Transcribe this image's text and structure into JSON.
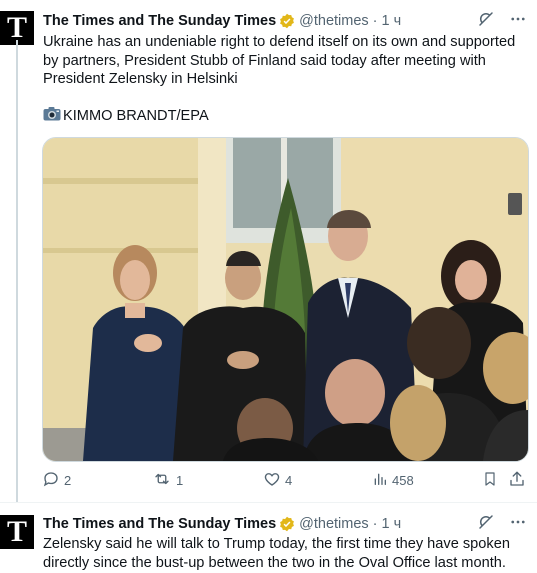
{
  "tweets": [
    {
      "author_name": "The Times and The Sunday Times",
      "handle": "@thetimes",
      "separator": "·",
      "time": "1 ч",
      "avatar_letter": "T",
      "text": "Ukraine has an undeniable right to defend itself on its own and supported by partners, President Stubb of Finland said today after meeting with President Zelensky in Helsinki",
      "photo_credit": "KIMMO BRANDT/EPA",
      "photo_credit_icon": "camera-icon",
      "stats": {
        "replies": "2",
        "reposts": "1",
        "likes": "4",
        "views": "458"
      }
    },
    {
      "author_name": "The Times and The Sunday Times",
      "handle": "@thetimes",
      "separator": "·",
      "time": "1 ч",
      "avatar_letter": "T",
      "text": "Zelensky said he will talk to Trump today, the first time they have spoken directly since the bust-up between the two in the Oval Office last month."
    }
  ],
  "colors": {
    "verified_badge": "#e2b719",
    "muted": "#536471",
    "border": "#cfd9de"
  },
  "icons": [
    "verified-badge-icon",
    "grok-icon",
    "more-icon",
    "reply-icon",
    "repost-icon",
    "like-icon",
    "views-icon",
    "bookmark-icon",
    "share-icon"
  ]
}
